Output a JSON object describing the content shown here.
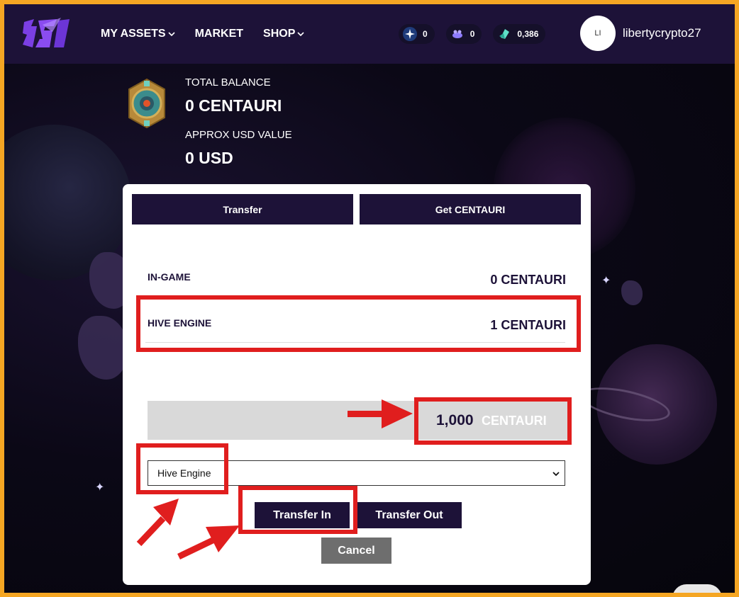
{
  "header": {
    "nav": [
      {
        "label": "MY ASSETS",
        "dropdown": true
      },
      {
        "label": "MARKET",
        "dropdown": false
      },
      {
        "label": "SHOP",
        "dropdown": true
      }
    ],
    "counters": [
      {
        "icon": "star-token-icon",
        "value": "0"
      },
      {
        "icon": "creature-token-icon",
        "value": "0"
      },
      {
        "icon": "crystal-token-icon",
        "value": "0,386"
      }
    ],
    "user": {
      "initials": "LI",
      "name": "libertycrypto27"
    }
  },
  "balance": {
    "total_label": "TOTAL BALANCE",
    "total_value": "0 CENTAURI",
    "usd_label": "APPROX USD VALUE",
    "usd_value": "0 USD"
  },
  "modal": {
    "tabs": [
      "Transfer",
      "Get CENTAURI"
    ],
    "rows": [
      {
        "label": "IN-GAME",
        "value": "0 CENTAURI"
      },
      {
        "label": "HIVE ENGINE",
        "value": "1 CENTAURI"
      }
    ],
    "amount": {
      "value": "1,000",
      "unit": "CENTAURI"
    },
    "select": {
      "selected": "Hive Engine"
    },
    "buttons": {
      "transfer_in": "Transfer In",
      "transfer_out": "Transfer Out",
      "cancel": "Cancel"
    }
  },
  "colors": {
    "frame": "#f5a623",
    "header_bg": "#1d1238",
    "button_bg": "#1d1238",
    "cancel_bg": "#6e6e6e",
    "highlight": "#e01e1e"
  }
}
